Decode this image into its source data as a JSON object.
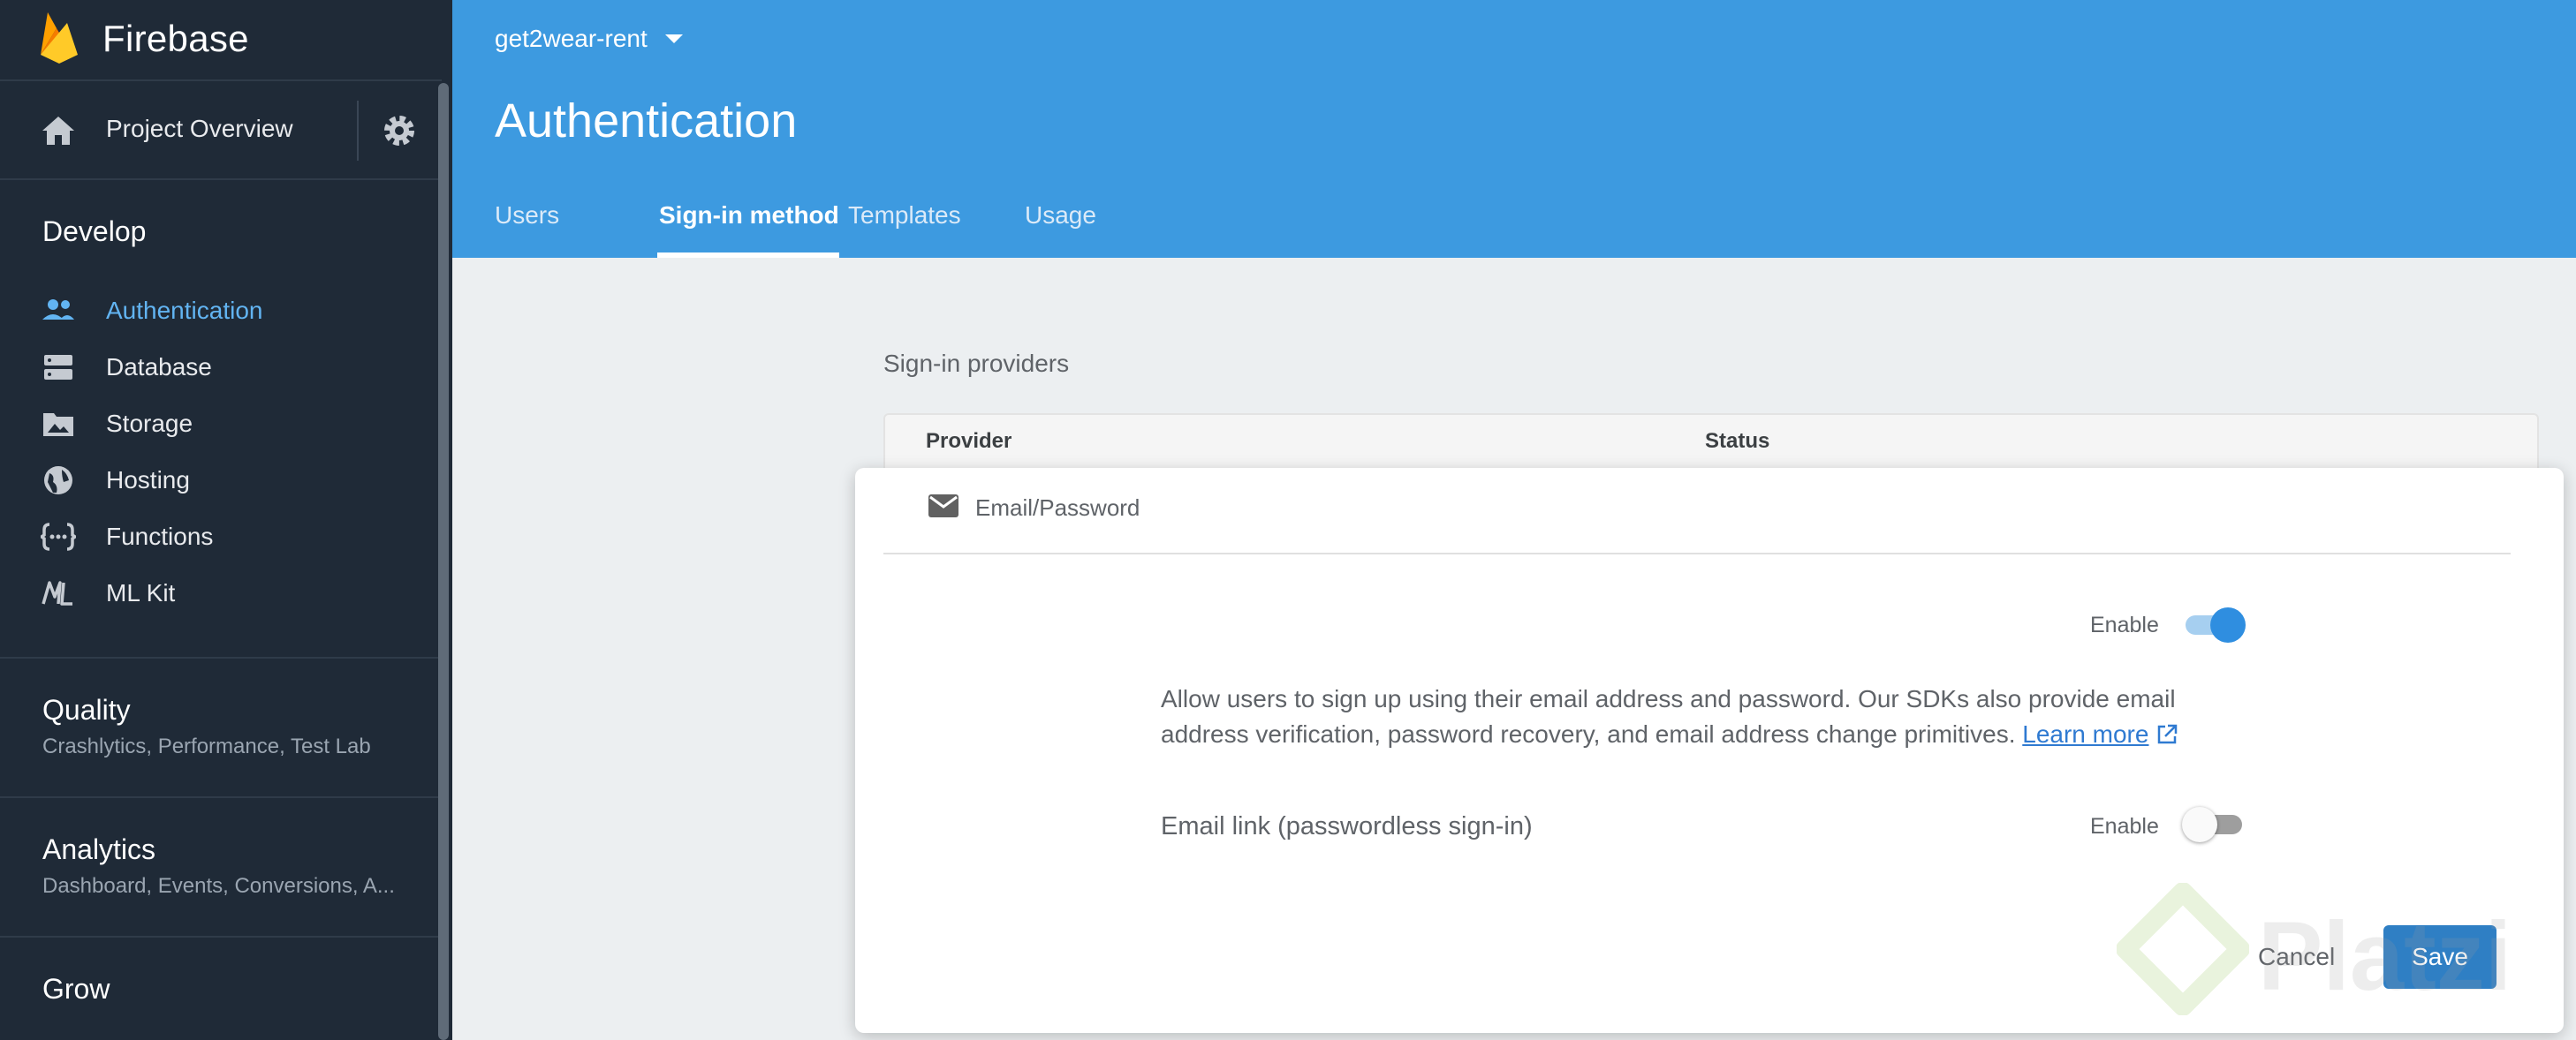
{
  "app": {
    "name": "Firebase"
  },
  "sidebar": {
    "overview_label": "Project Overview",
    "develop": {
      "title": "Develop",
      "items": [
        {
          "label": "Authentication",
          "icon": "people-icon",
          "active": true
        },
        {
          "label": "Database",
          "icon": "database-icon",
          "active": false
        },
        {
          "label": "Storage",
          "icon": "image-folder-icon",
          "active": false
        },
        {
          "label": "Hosting",
          "icon": "globe-icon",
          "active": false
        },
        {
          "label": "Functions",
          "icon": "braces-icon",
          "active": false
        },
        {
          "label": "ML Kit",
          "icon": "ml-icon",
          "active": false
        }
      ]
    },
    "quality": {
      "title": "Quality",
      "subtitle": "Crashlytics, Performance, Test Lab"
    },
    "analytics": {
      "title": "Analytics",
      "subtitle": "Dashboard, Events, Conversions, A..."
    },
    "grow": {
      "title": "Grow"
    }
  },
  "header": {
    "project": "get2wear-rent",
    "title": "Authentication",
    "tabs": [
      {
        "label": "Users",
        "active": false
      },
      {
        "label": "Sign-in method",
        "active": true
      },
      {
        "label": "Templates",
        "active": false
      },
      {
        "label": "Usage",
        "active": false
      }
    ]
  },
  "main": {
    "section_title": "Sign-in providers",
    "columns": {
      "provider": "Provider",
      "status": "Status"
    },
    "provider": {
      "name": "Email/Password",
      "icon": "mail-icon",
      "enable_label": "Enable",
      "enabled": true,
      "description": "Allow users to sign up using their email address and password. Our SDKs also provide email address verification, password recovery, and email address change primitives.",
      "learn_more": "Learn more",
      "email_link_label": "Email link (passwordless sign-in)",
      "email_link_enable_label": "Enable",
      "email_link_enabled": false
    },
    "actions": {
      "cancel": "Cancel",
      "save": "Save"
    }
  },
  "watermark": {
    "text": "Platzi"
  },
  "colors": {
    "header": "#3d9ae0",
    "sidebar": "#1f2a37",
    "accent": "#2f8ee0",
    "active_nav": "#62b4f2"
  }
}
